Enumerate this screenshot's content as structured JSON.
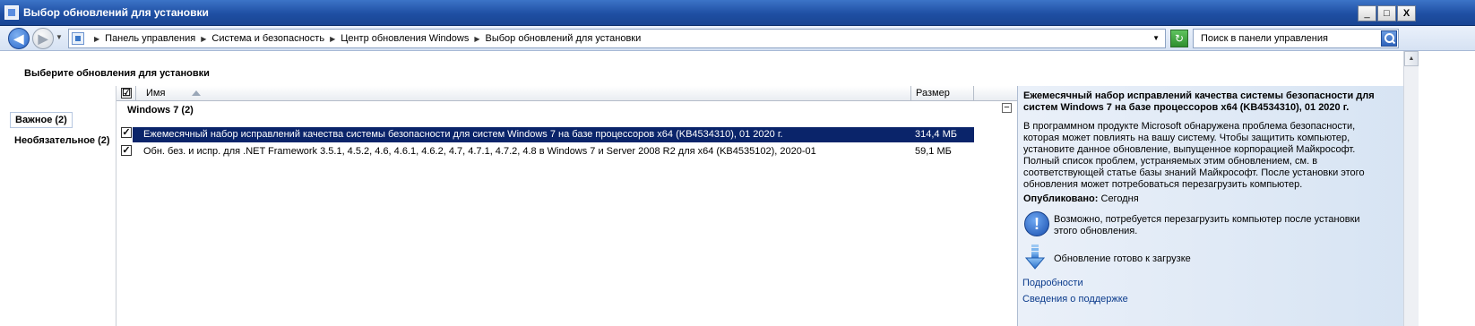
{
  "window": {
    "title": "Выбор обновлений для установки",
    "controls": {
      "minimize": "_",
      "maximize": "□",
      "close": "X"
    }
  },
  "address": {
    "breadcrumbs": [
      "Панель управления",
      "Система и безопасность",
      "Центр обновления Windows",
      "Выбор обновлений для установки"
    ],
    "search_placeholder": "Поиск в панели управления"
  },
  "page": {
    "heading": "Выберите обновления для установки"
  },
  "sidebar": {
    "items": [
      {
        "label": "Важное (2)",
        "selected": true
      },
      {
        "label": "Необязательное (2)",
        "selected": false
      }
    ]
  },
  "list": {
    "columns": {
      "name": "Имя",
      "size": "Размер"
    },
    "header_checkbox": "☑",
    "group_title": "Windows 7 (2)",
    "collapse_symbol": "−",
    "rows": [
      {
        "checked": "✓",
        "name": "Ежемесячный набор исправлений качества системы безопасности для систем Windows 7 на базе процессоров x64 (KB4534310), 01 2020 г.",
        "size": "314,4 МБ",
        "selected": true
      },
      {
        "checked": "✓",
        "name": "Обн. без. и испр. для .NET Framework 3.5.1, 4.5.2, 4.6, 4.6.1, 4.6.2, 4.7, 4.7.1, 4.7.2, 4.8 в Windows 7 и Server 2008 R2 для x64 (KB4535102), 2020-01",
        "size": "59,1 МБ",
        "selected": false
      }
    ]
  },
  "details": {
    "title": "Ежемесячный набор исправлений качества системы безопасности для систем Windows 7 на базе процессоров x64 (KB4534310), 01 2020 г.",
    "description": "В программном продукте Microsoft обнаружена проблема безопасности, которая может повлиять на вашу систему. Чтобы защитить компьютер, установите данное обновление, выпущенное корпорацией Майкрософт. Полный список проблем, устраняемых этим обновлением, см. в соответствующей статье базы знаний Майкрософт. После установки этого обновления может потребоваться перезагрузить компьютер.",
    "published_label": "Опубликовано:",
    "published_value": "Сегодня",
    "restart_note": "Возможно, потребуется перезагрузить компьютер после установки этого обновления.",
    "download_status": "Обновление готово к загрузке",
    "links": [
      "Подробности",
      "Сведения о поддержке"
    ],
    "info_icon_glyph": "!"
  },
  "icons": {
    "back": "arrow-left-icon",
    "forward": "arrow-right-icon",
    "refresh": "refresh-icon",
    "search": "search-icon",
    "info": "info-icon",
    "download": "download-arrow-icon"
  },
  "colors": {
    "titlebar": "#1f4fa3",
    "selection": "#0a246a",
    "details_bg": "#dfe8f5",
    "link": "#0b3b8c"
  }
}
